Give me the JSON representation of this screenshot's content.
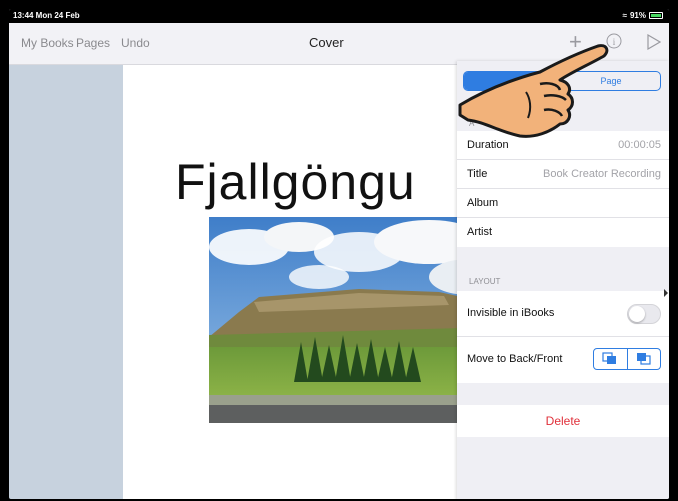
{
  "status_bar": {
    "time": "13:44  Mon 24 Feb",
    "battery": "91%"
  },
  "nav": {
    "my_books": "My Books",
    "pages": "Pages",
    "undo": "Undo",
    "title": "Cover",
    "add_icon": "plus-icon",
    "info_icon": "info-icon",
    "play_icon": "play-icon"
  },
  "page": {
    "title": "Fjallgöngu"
  },
  "panel": {
    "tabs": [
      "",
      "Page"
    ],
    "audio_header": "A",
    "audio_rows": [
      {
        "label": "Duration",
        "value": "00:00:05"
      },
      {
        "label": "Title",
        "value": "Book Creator Recording"
      },
      {
        "label": "Album",
        "value": ""
      },
      {
        "label": "Artist",
        "value": ""
      }
    ],
    "layout_header": "LAYOUT",
    "invisible_label": "Invisible in iBooks",
    "invisible_on": false,
    "move_label": "Move to Back/Front",
    "delete_label": "Delete"
  },
  "colors": {
    "accent": "#2f7de1",
    "delete": "#e0303a"
  }
}
